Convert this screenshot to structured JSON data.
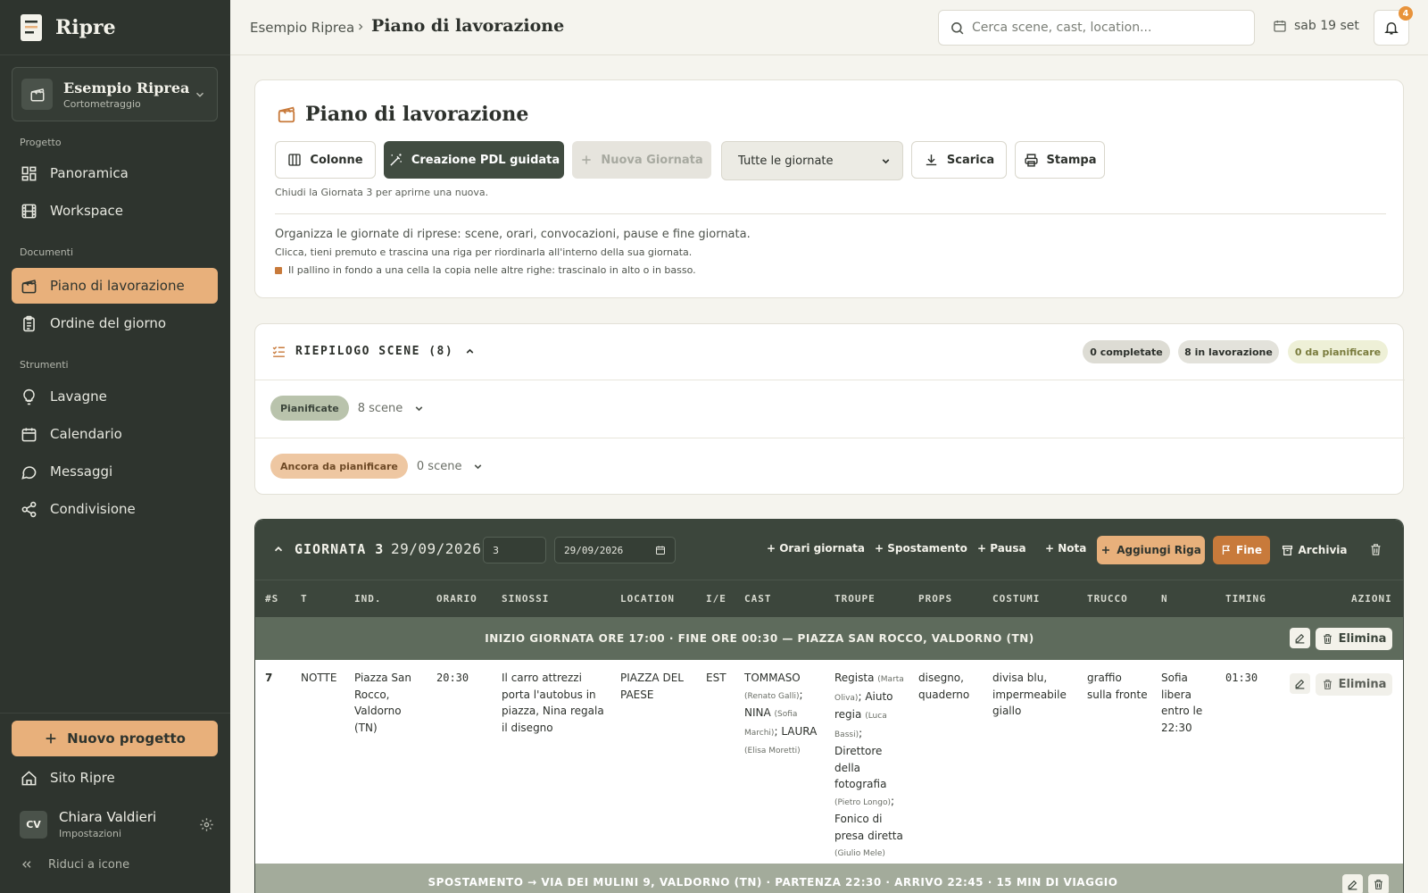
{
  "sidebar": {
    "brand": "Ripre",
    "project": {
      "title": "Esempio Riprea",
      "subtitle": "Cortometraggio"
    },
    "sections": {
      "progetto": "Progetto",
      "documenti": "Documenti",
      "strumenti": "Strumenti"
    },
    "items": {
      "panoramica": "Panoramica",
      "workspace": "Workspace",
      "piano": "Piano di lavorazione",
      "ordine": "Ordine del giorno",
      "lavagne": "Lavagne",
      "calendario": "Calendario",
      "messaggi": "Messaggi",
      "condivisione": "Condivisione"
    },
    "new_project": "Nuovo progetto",
    "site": "Sito Ripre",
    "user": {
      "initials": "CV",
      "name": "Chiara Valdieri",
      "sub": "Impostazioni"
    },
    "collapse": "Riduci a icone"
  },
  "topbar": {
    "crumb_parent": "Esempio Riprea",
    "crumb_current": "Piano di lavorazione",
    "search_placeholder": "Cerca scene, cast, location...",
    "date": "sab 19 set",
    "notifications": "4"
  },
  "pdl": {
    "title": "Piano di lavorazione",
    "btn_columns": "Colonne",
    "btn_guided": "Creazione PDL guidata",
    "btn_new_day": "Nuova Giornata",
    "select_value": "Tutte le giornate",
    "btn_download": "Scarica",
    "btn_print": "Stampa",
    "note": "Chiudi la Giornata 3 per aprirne una nuova.",
    "desc1": "Organizza le giornate di riprese: scene, orari, convocazioni, pause e fine giornata.",
    "desc2": "Clicca, tieni premuto e trascina una riga per riordinarla all'interno della sua giornata.",
    "desc3": "Il pallino in fondo a una cella la copia nelle altre righe: trascinalo in alto o in basso."
  },
  "riepilogo": {
    "title": "RIEPILOGO SCENE (8)",
    "completed": "0 completate",
    "in_progress": "8 in lavorazione",
    "to_plan": "0 da pianificare",
    "planned_tag": "Pianificate",
    "planned_count": "8 scene",
    "unplanned_tag": "Ancora da pianificare",
    "unplanned_count": "0 scene"
  },
  "giornata": {
    "title": "GIORNATA 3",
    "date": "29/09/2026",
    "num_input": "3",
    "date_input": "29/09/2026",
    "actions": {
      "orari": "+ Orari giornata",
      "spostamento": "+ Spostamento",
      "pausa": "+ Pausa",
      "nota": "+ Nota",
      "aggiungi": "Aggiungi Riga",
      "fine": "Fine",
      "archivia": "Archivia"
    },
    "columns": [
      "#S",
      "T",
      "IND.",
      "ORARIO",
      "SINOSSI",
      "LOCATION",
      "I/E",
      "CAST",
      "TROUPE",
      "PROPS",
      "COSTUMI",
      "TRUCCO",
      "N",
      "TIMING",
      "AZIONI"
    ],
    "start_row": "INIZIO GIORNATA ORE 17:00 · FINE ORE 00:30 — PIAZZA SAN ROCCO, VALDORNO (TN)",
    "delete_label": "Elimina",
    "scene": {
      "num": "7",
      "time_of_day": "NOTTE",
      "address": "Piazza San Rocco, Valdorno (TN)",
      "orario": "20:30",
      "sinossi": "Il carro attrezzi porta l'autobus in piazza, Nina regala il disegno",
      "location": "PIAZZA DEL PAESE",
      "ie": "EST",
      "cast": [
        {
          "role": "TOMMASO",
          "actor": "(Renato Galli)",
          "sep": ";"
        },
        {
          "role": "NINA",
          "actor": "(Sofia Marchi)",
          "sep": ";"
        },
        {
          "role": "LAURA",
          "actor": "(Elisa Moretti)",
          "sep": ""
        }
      ],
      "troupe": [
        {
          "role": "Regista",
          "person": "(Marta Oliva)",
          "sep": ";"
        },
        {
          "role": "Aiuto regia",
          "person": "(Luca Bassi)",
          "sep": ";"
        },
        {
          "role": "Direttore della fotografia",
          "person": "(Pietro Longo)",
          "sep": ";"
        },
        {
          "role": "Fonico di presa diretta",
          "person": "(Giulio Mele)",
          "sep": ""
        }
      ],
      "props": "disegno, quaderno",
      "costumi": "divisa blu, impermeabile giallo",
      "trucco": "graffio sulla fronte",
      "note": "Sofia libera entro le 22:30",
      "timing": "01:30"
    },
    "move_row": "SPOSTAMENTO → VIA DEI MULINI 9, VALDORNO (TN) · PARTENZA 22:30 · ARRIVO 22:45 · 15 MIN DI VIAGGIO"
  },
  "colors": {
    "sidebar": "#2e342e",
    "accent": "#e8b07b",
    "dark": "#3c463c",
    "background": "#f5f4ee"
  }
}
